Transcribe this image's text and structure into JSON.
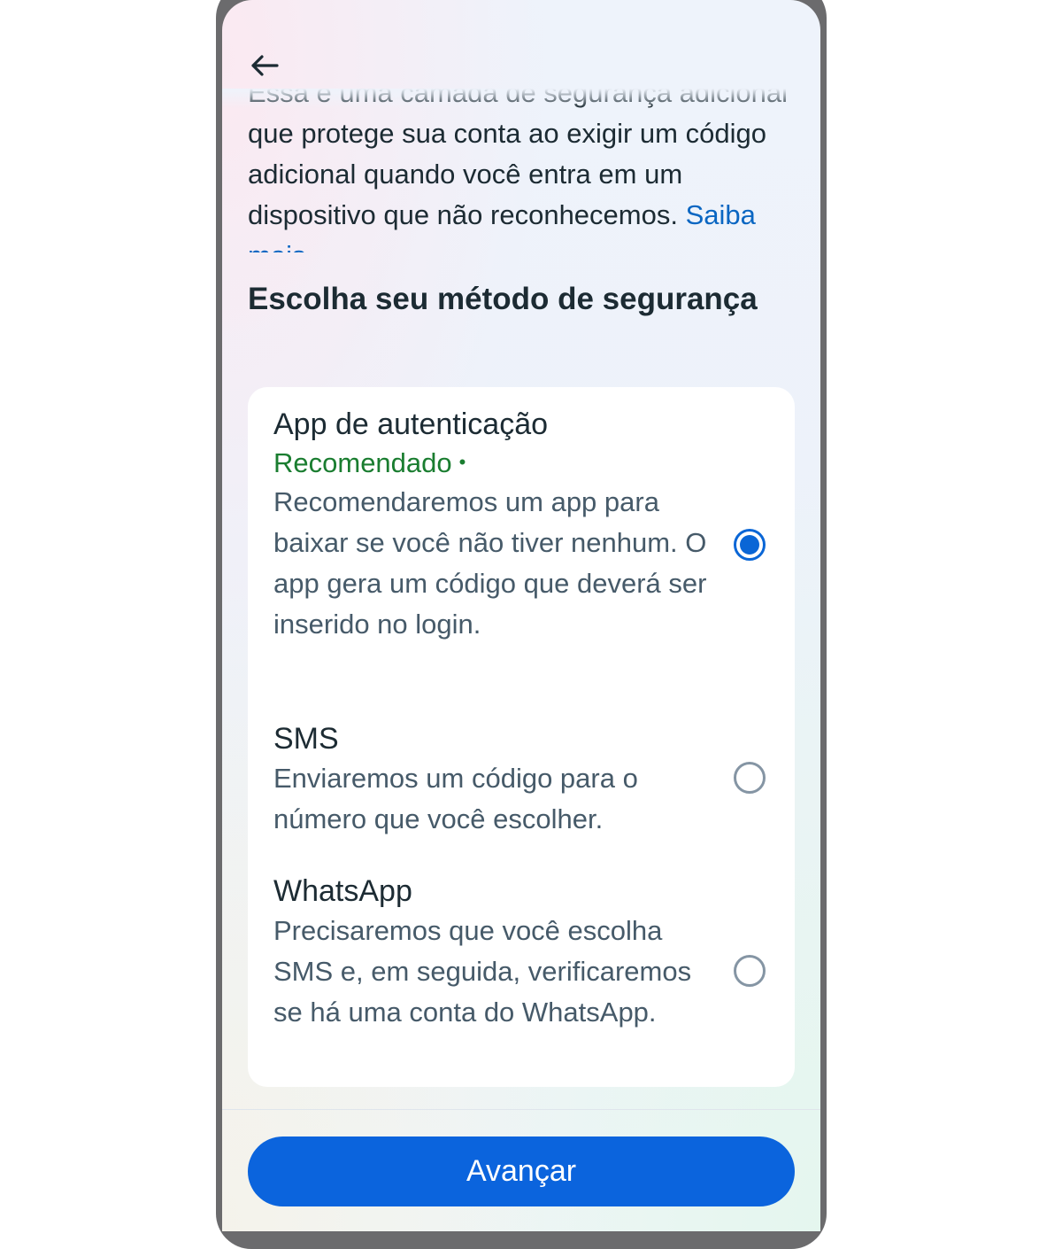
{
  "header": {
    "back_icon": "arrow-left-icon"
  },
  "intro": {
    "text": "Essa é uma camada de segurança adicional que protege sua conta ao exigir um código adicional quando você entra em um dispositivo que não reconhecemos.",
    "link_label": "Saiba mais",
    "link_color": "#0a66c2"
  },
  "section": {
    "title": "Escolha seu método de segurança"
  },
  "options": [
    {
      "title": "App de autenticação",
      "tag": "Recomendado",
      "tag_color": "#1a7d30",
      "description": "Recomendaremos um app para baixar se você não tiver nenhum. O app gera um código que deverá ser inserido no login.",
      "selected": true
    },
    {
      "title": "SMS",
      "description": "Enviaremos um código para o número que você escolher.",
      "selected": false
    },
    {
      "title": "WhatsApp",
      "description": "Precisaremos que você escolha SMS e, em seguida, verificaremos se há uma conta do WhatsApp.",
      "selected": false
    }
  ],
  "footer": {
    "next_label": "Avançar",
    "button_color": "#0b64dd"
  }
}
